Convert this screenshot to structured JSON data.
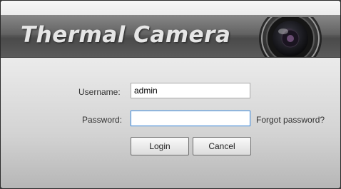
{
  "banner": {
    "title": "Thermal Camera"
  },
  "login_form": {
    "username_label": "Username:",
    "username_value": "admin",
    "password_label": "Password:",
    "password_value": "",
    "forgot_password_label": "Forgot password?",
    "login_label": "Login",
    "cancel_label": "Cancel"
  },
  "icons": {
    "banner_graphic": "camera-lens-icon"
  },
  "colors": {
    "banner": "#5c5c5c",
    "focus_border": "#4a90d9",
    "background_top": "#f4f4f4",
    "background_bottom": "#b6b6b6"
  }
}
